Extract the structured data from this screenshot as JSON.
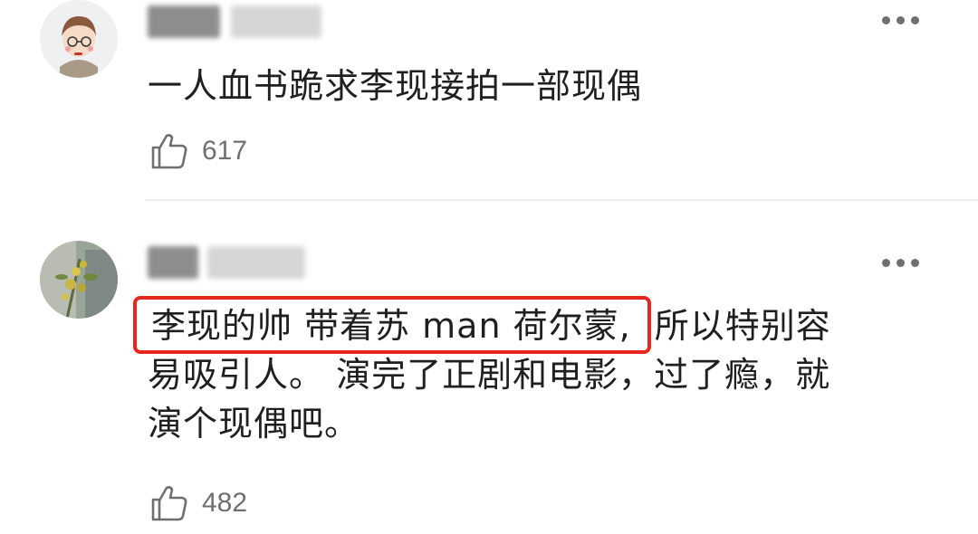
{
  "comments": [
    {
      "avatar": "cartoon-boy-avatar",
      "content": "一人血书跪求李现接拍一部现偶",
      "likes": "617",
      "more_icon": "more-dots-icon"
    },
    {
      "avatar": "plant-photo-avatar",
      "content_highlight": "李现的帅 带着苏 man 荷尔蒙,",
      "content_line1_rest": "所以特别容",
      "content_line2": "易吸引人。 演完了正剧和电影，过了瘾，就",
      "content_line3": "演个现偶吧。",
      "likes": "482",
      "more_icon": "more-dots-icon"
    }
  ],
  "colors": {
    "highlight_border": "#e8261e",
    "text": "#1f1f1f",
    "secondary_text": "#6f6f6f",
    "divider": "#eeeeee"
  }
}
